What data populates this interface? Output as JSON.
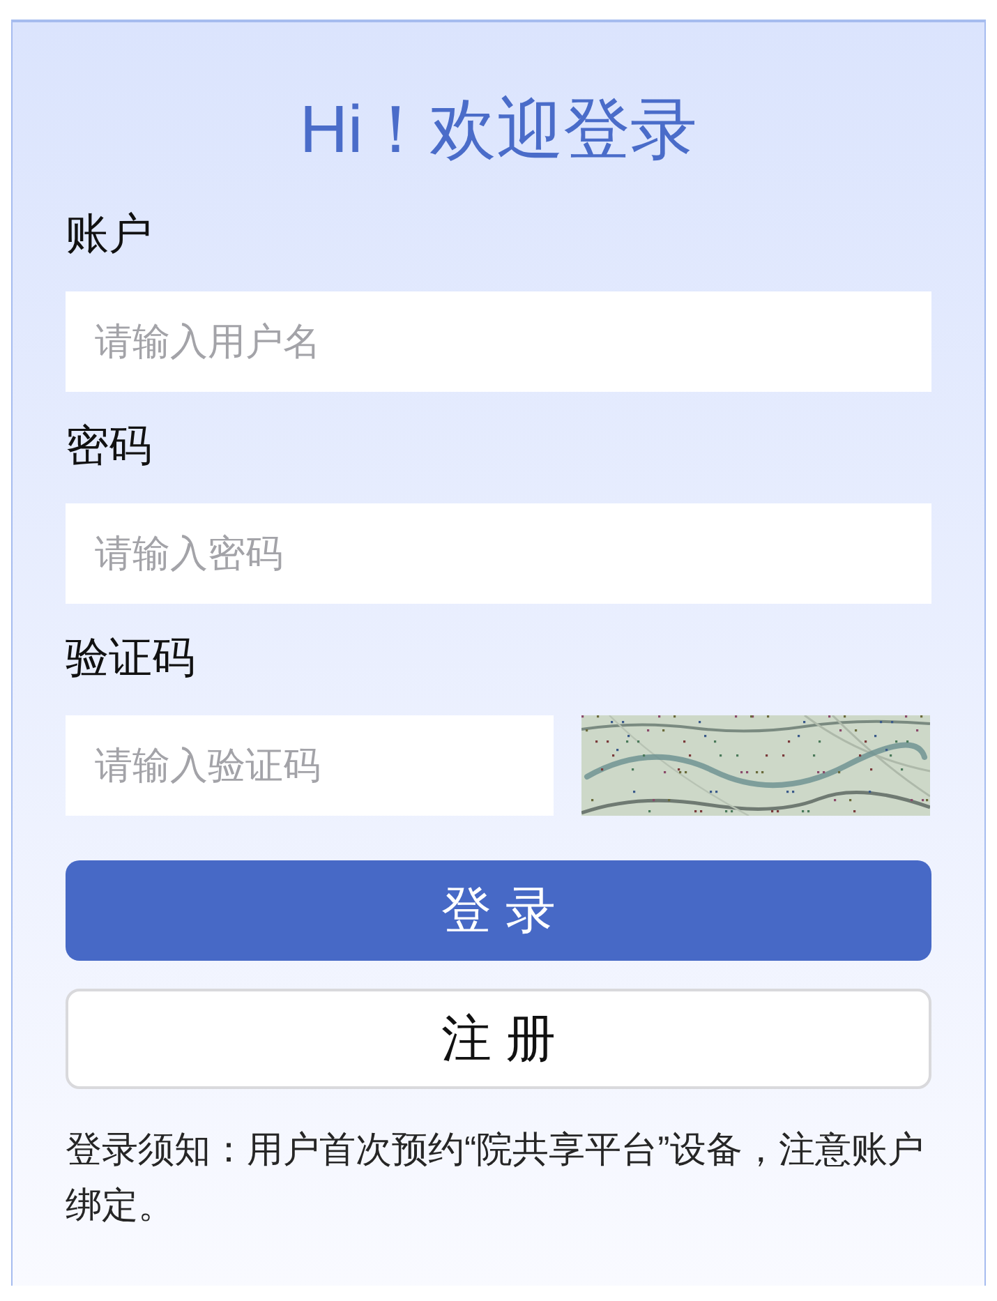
{
  "title": "Hi！欢迎登录",
  "fields": [
    {
      "label": "账户",
      "placeholder": "请输入用户名",
      "kind": "text"
    },
    {
      "label": "密码",
      "placeholder": "请输入密码",
      "kind": "password"
    },
    {
      "label": "验证码",
      "placeholder": "请输入验证码",
      "kind": "captcha"
    }
  ],
  "buttons": [
    {
      "label": "登 录",
      "kind": "primary"
    },
    {
      "label": "注 册",
      "kind": "secondary"
    }
  ],
  "notice": "登录须知：用户首次预约“院共享平台”设备，注意账户绑定。"
}
